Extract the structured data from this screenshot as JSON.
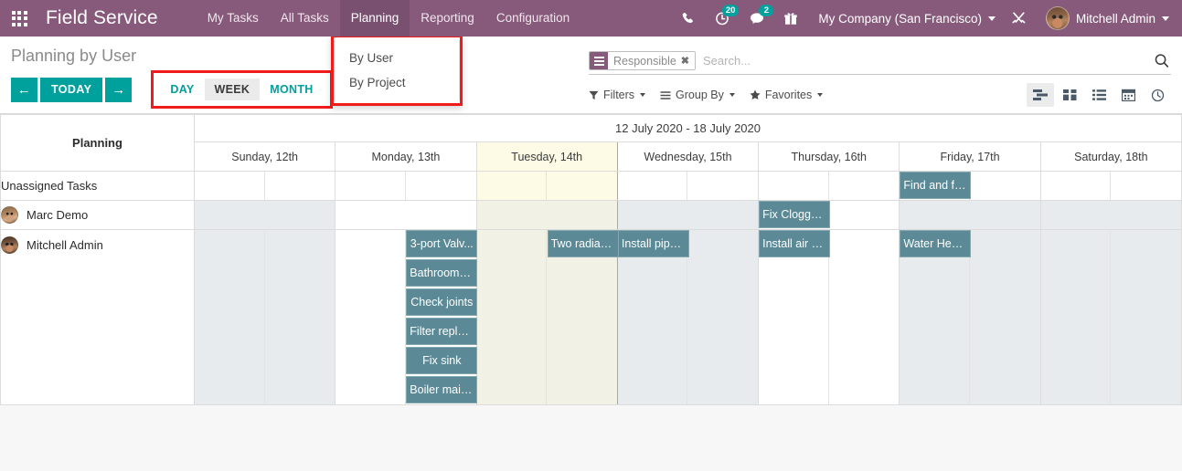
{
  "navbar": {
    "apps_icon": "apps-grid-icon",
    "brand": "Field Service",
    "menu": [
      {
        "label": "My Tasks",
        "active": false
      },
      {
        "label": "All Tasks",
        "active": false
      },
      {
        "label": "Planning",
        "active": true
      },
      {
        "label": "Reporting",
        "active": false
      },
      {
        "label": "Configuration",
        "active": false
      }
    ],
    "icons": {
      "phone": "phone-icon",
      "activity": "clock-activity-icon",
      "activity_count": "20",
      "messages": "chat-bubble-icon",
      "messages_count": "2",
      "gift": "gift-icon",
      "tools": "wrench-tools-icon"
    },
    "company": "My Company (San Francisco)",
    "user": "Mitchell Admin",
    "accent": "#875A7B"
  },
  "control_panel": {
    "breadcrumb": "Planning by User",
    "prev_label": "←",
    "today_label": "TODAY",
    "next_label": "→",
    "scales": [
      {
        "label": "DAY",
        "active": false
      },
      {
        "label": "WEEK",
        "active": true
      },
      {
        "label": "MONTH",
        "active": false
      }
    ],
    "dropdown": {
      "items": [
        "By User",
        "By Project"
      ]
    },
    "search": {
      "facet_label": "Responsible",
      "facet_remove": "✖",
      "placeholder": "Search..."
    },
    "filters": [
      {
        "label": "Filters",
        "icon": "filter-funnel-icon"
      },
      {
        "label": "Group By",
        "icon": "group-by-lines-icon"
      },
      {
        "label": "Favorites",
        "icon": "star-icon"
      }
    ],
    "views": [
      {
        "name": "gantt-view-icon",
        "active": true
      },
      {
        "name": "kanban-view-icon",
        "active": false
      },
      {
        "name": "list-view-icon",
        "active": false
      },
      {
        "name": "calendar-view-icon",
        "active": false
      },
      {
        "name": "activity-view-icon",
        "active": false
      }
    ],
    "accent_teal": "#00A09D",
    "highlight_red": "#f01b1b"
  },
  "gantt": {
    "corner_label": "Planning",
    "date_range": "12 July 2020 - 18 July 2020",
    "days": [
      {
        "label": "Sunday, 12th",
        "today": false,
        "weekend": true
      },
      {
        "label": "Monday, 13th",
        "today": false,
        "weekend": false
      },
      {
        "label": "Tuesday, 14th",
        "today": true,
        "weekend": false
      },
      {
        "label": "Wednesday, 15th",
        "today": false,
        "weekend": false
      },
      {
        "label": "Thursday, 16th",
        "today": false,
        "weekend": false
      },
      {
        "label": "Friday, 17th",
        "today": false,
        "weekend": false
      },
      {
        "label": "Saturday, 18th",
        "today": false,
        "weekend": true
      }
    ],
    "rows": [
      {
        "label": "Unassigned Tasks",
        "avatar": false
      },
      {
        "label": "Marc Demo",
        "avatar": true,
        "avatar_name": "avatar-marc-demo"
      },
      {
        "label": "Mitchell Admin",
        "avatar": true,
        "avatar_name": "avatar-mitchell-admin"
      }
    ],
    "pill_color": "#5B8A96",
    "tasks": {
      "unassigned": [
        {
          "label": "Find and fix...",
          "day": 5,
          "half": 0,
          "span": 1,
          "stack": 0
        }
      ],
      "marc_demo": [
        {
          "label": "Fix Clogged...",
          "day": 4,
          "half": 0,
          "span": 1,
          "stack": 0
        }
      ],
      "mitchell_admin": [
        {
          "label": "3-port Valv...",
          "day": 1,
          "half": 1,
          "span": 1,
          "stack": 0
        },
        {
          "label": "Bathroom v...",
          "day": 1,
          "half": 1,
          "span": 1,
          "stack": 1
        },
        {
          "label": "Check joints",
          "day": 1,
          "half": 1,
          "span": 1,
          "stack": 2
        },
        {
          "label": "Filter replac...",
          "day": 1,
          "half": 1,
          "span": 1,
          "stack": 3
        },
        {
          "label": "Fix sink",
          "day": 1,
          "half": 1,
          "span": 1,
          "stack": 4
        },
        {
          "label": "Boiler main...",
          "day": 1,
          "half": 1,
          "span": 1,
          "stack": 5
        },
        {
          "label": "Two radiato...",
          "day": 2,
          "half": 1,
          "span": 1,
          "stack": 0
        },
        {
          "label": "Install pipel...",
          "day": 3,
          "half": 0,
          "span": 1,
          "stack": 0
        },
        {
          "label": "Install air e...",
          "day": 4,
          "half": 0,
          "span": 1,
          "stack": 0
        },
        {
          "label": "Water Heater",
          "day": 5,
          "half": 0,
          "span": 1,
          "stack": 0
        }
      ]
    }
  }
}
